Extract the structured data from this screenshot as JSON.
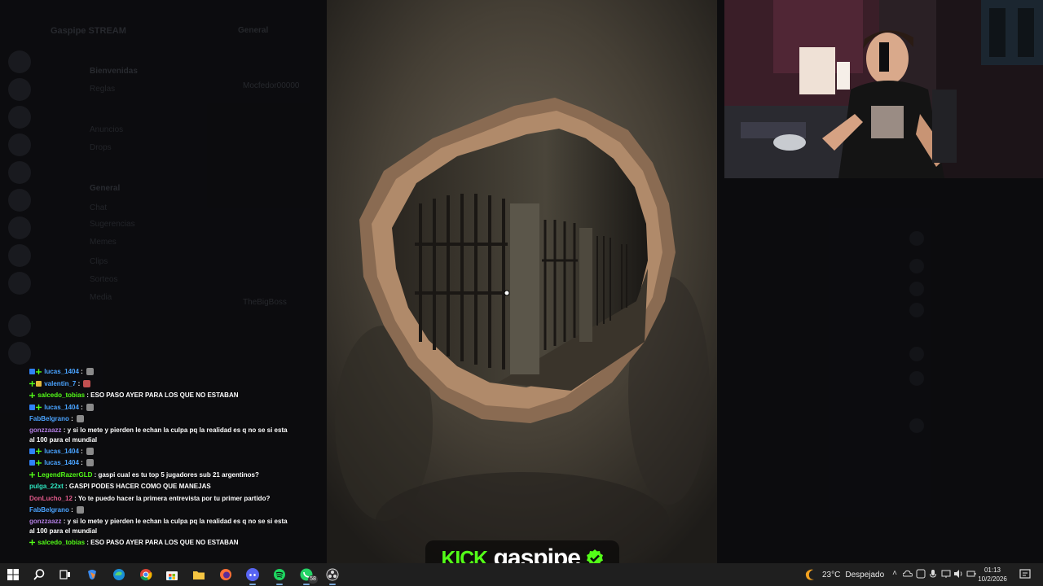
{
  "discord": {
    "server_name": "Gaspipe STREAM",
    "header_channel": "General",
    "categories": [
      "Bienvenidas",
      "General"
    ],
    "channels": [
      "Reglas",
      "Anuncios",
      "Drops",
      "Chat",
      "Sugerencias",
      "Memes",
      "Clips",
      "Sorteos",
      "Media"
    ],
    "msg_names": [
      "Mocfedor00000",
      "TheBigBoss"
    ]
  },
  "chat": {
    "messages": [
      {
        "user": "lucas_1404",
        "color": "#4aa3ff",
        "badges": [
          "blue",
          "green"
        ],
        "text": "",
        "emote": "gray"
      },
      {
        "user": "valentin_7",
        "color": "#4aa3ff",
        "badges": [
          "green",
          "yellow"
        ],
        "text": "",
        "emote": "red"
      },
      {
        "user": "salcedo_tobias",
        "color": "#53fc18",
        "badges": [
          "green"
        ],
        "text": "ESO PASO AYER PARA LOS QUE NO ESTABAN",
        "emote": ""
      },
      {
        "user": "lucas_1404",
        "color": "#4aa3ff",
        "badges": [
          "blue",
          "green"
        ],
        "text": "",
        "emote": "gray"
      },
      {
        "user": "FabBelgrano",
        "color": "#4aa3ff",
        "badges": [],
        "text": "",
        "emote": "gray"
      },
      {
        "user": "gonzzaazz",
        "color": "#b07de0",
        "badges": [],
        "text": "y si lo mete y pierden le echan la culpa pq la realidad es q no se si esta al 100 para el mundial",
        "emote": ""
      },
      {
        "user": "lucas_1404",
        "color": "#4aa3ff",
        "badges": [
          "blue",
          "green"
        ],
        "text": "",
        "emote": "gray"
      },
      {
        "user": "lucas_1404",
        "color": "#4aa3ff",
        "badges": [
          "blue",
          "green"
        ],
        "text": "",
        "emote": "gray"
      },
      {
        "user": "LegendRazerGLD",
        "color": "#53fc18",
        "badges": [
          "green"
        ],
        "text": "gaspi cual es tu top 5 jugadores sub 21 argentinos?",
        "emote": ""
      },
      {
        "user": "pulga_22xt",
        "color": "#2ee6c0",
        "badges": [],
        "text": "GASPI PODES HACER COMO QUE MANEJAS",
        "emote": ""
      },
      {
        "user": "DonLucho_12",
        "color": "#e05a8a",
        "badges": [],
        "text": "Yo te puedo hacer la primera entrevista por tu primer partido?",
        "emote": ""
      },
      {
        "user": "FabBelgrano",
        "color": "#4aa3ff",
        "badges": [],
        "text": "",
        "emote": "gray"
      },
      {
        "user": "gonzzaazz",
        "color": "#b07de0",
        "badges": [],
        "text": "y si lo mete y pierden le echan la culpa pq la realidad es q no se si esta al 100 para el mundial",
        "emote": ""
      },
      {
        "user": "salcedo_tobias",
        "color": "#53fc18",
        "badges": [
          "green"
        ],
        "text": "ESO PASO AYER PARA LOS QUE NO ESTABAN",
        "emote": ""
      }
    ]
  },
  "logo": {
    "platform": "KICK",
    "channel": "gaspipe",
    "brand_color": "#53fc18"
  },
  "taskbar": {
    "apps": [
      "windows-start",
      "search",
      "task-view",
      "copilot",
      "edge",
      "chrome",
      "store",
      "file-explorer",
      "firefox",
      "discord",
      "spotify",
      "whatsapp",
      "obs"
    ],
    "whatsapp_badge": "58",
    "weather_temp": "23°C",
    "weather_condition": "Despejado",
    "time": "01:13",
    "date": "10/2/2026"
  }
}
